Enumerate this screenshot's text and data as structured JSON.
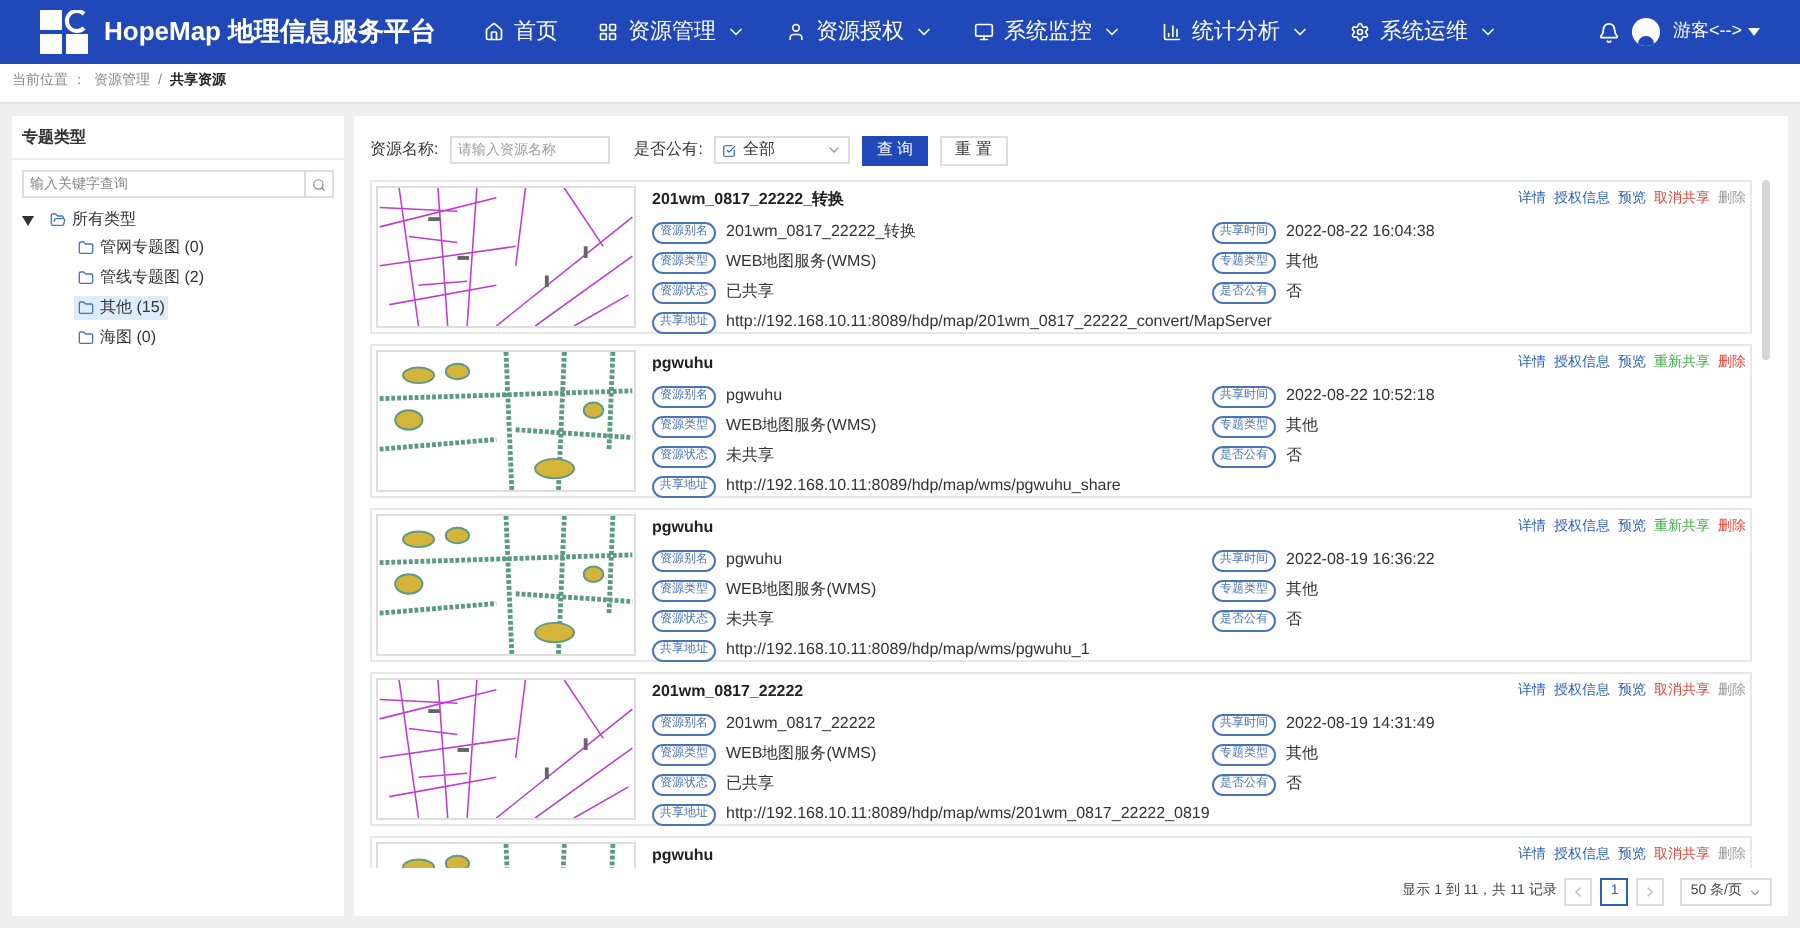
{
  "header": {
    "title": "HopeMap 地理信息服务平台",
    "nav": [
      {
        "label": "首页",
        "dropdown": false
      },
      {
        "label": "资源管理",
        "dropdown": true
      },
      {
        "label": "资源授权",
        "dropdown": true
      },
      {
        "label": "系统监控",
        "dropdown": true
      },
      {
        "label": "统计分析",
        "dropdown": true
      },
      {
        "label": "系统运维",
        "dropdown": true
      }
    ],
    "user": "游客<-->"
  },
  "breadcrumb": {
    "label": "当前位置 ：",
    "items": [
      {
        "label": "资源管理",
        "current": false
      },
      {
        "label": "共享资源",
        "current": true
      }
    ],
    "separator": "/"
  },
  "sidebar": {
    "title": "专题类型",
    "search_placeholder": "输入关键字查询",
    "tree": [
      {
        "label": "所有类型",
        "expanded": true,
        "selected": false,
        "children": [
          {
            "label": "管网专题图 (0)",
            "selected": false
          },
          {
            "label": "管线专题图 (2)",
            "selected": false
          },
          {
            "label": "其他 (15)",
            "selected": true
          },
          {
            "label": "海图 (0)",
            "selected": false
          }
        ]
      }
    ]
  },
  "filters": {
    "name_label": "资源名称:",
    "name_placeholder": "请输入资源名称",
    "public_label": "是否公有:",
    "public_value": "全部",
    "public_checked": true,
    "query_button": "查 询",
    "reset_button": "重 置"
  },
  "cards": [
    {
      "title": "201wm_0817_22222_转换",
      "kind": "lines",
      "actions": [
        {
          "label": "详情",
          "kind": "link"
        },
        {
          "label": "授权信息",
          "kind": "link"
        },
        {
          "label": "预览",
          "kind": "link"
        },
        {
          "label": "取消共享",
          "kind": "danger"
        },
        {
          "label": "删除",
          "kind": "muted"
        }
      ],
      "fields": [
        {
          "label": "资源别名",
          "value": "201wm_0817_22222_转换",
          "kind": "pair"
        },
        {
          "label": "共享时间",
          "value": "2022-08-22 16:04:38",
          "kind": "pair"
        },
        {
          "label": "资源类型",
          "value": "WEB地图服务(WMS)",
          "kind": "pair"
        },
        {
          "label": "专题类型",
          "value": "其他",
          "kind": "pair"
        },
        {
          "label": "资源状态",
          "value": "已共享",
          "kind": "pair"
        },
        {
          "label": "是否公有",
          "value": "否",
          "kind": "pair"
        },
        {
          "label": "共享地址",
          "value": "http://192.168.10.11:8089/hdp/map/201wm_0817_22222_convert/MapServer",
          "kind": "wide"
        }
      ]
    },
    {
      "title": "pgwuhu",
      "kind": "patches",
      "actions": [
        {
          "label": "详情",
          "kind": "link"
        },
        {
          "label": "授权信息",
          "kind": "link"
        },
        {
          "label": "预览",
          "kind": "link"
        },
        {
          "label": "重新共享",
          "kind": "success"
        },
        {
          "label": "删除",
          "kind": "danger"
        }
      ],
      "fields": [
        {
          "label": "资源别名",
          "value": "pgwuhu",
          "kind": "pair"
        },
        {
          "label": "共享时间",
          "value": "2022-08-22 10:52:18",
          "kind": "pair"
        },
        {
          "label": "资源类型",
          "value": "WEB地图服务(WMS)",
          "kind": "pair"
        },
        {
          "label": "专题类型",
          "value": "其他",
          "kind": "pair"
        },
        {
          "label": "资源状态",
          "value": "未共享",
          "kind": "pair"
        },
        {
          "label": "是否公有",
          "value": "否",
          "kind": "pair"
        },
        {
          "label": "共享地址",
          "value": "http://192.168.10.11:8089/hdp/map/wms/pgwuhu_share",
          "kind": "wide"
        }
      ]
    },
    {
      "title": "pgwuhu",
      "kind": "patches",
      "actions": [
        {
          "label": "详情",
          "kind": "link"
        },
        {
          "label": "授权信息",
          "kind": "link"
        },
        {
          "label": "预览",
          "kind": "link"
        },
        {
          "label": "重新共享",
          "kind": "success"
        },
        {
          "label": "删除",
          "kind": "danger"
        }
      ],
      "fields": [
        {
          "label": "资源别名",
          "value": "pgwuhu",
          "kind": "pair"
        },
        {
          "label": "共享时间",
          "value": "2022-08-19 16:36:22",
          "kind": "pair"
        },
        {
          "label": "资源类型",
          "value": "WEB地图服务(WMS)",
          "kind": "pair"
        },
        {
          "label": "专题类型",
          "value": "其他",
          "kind": "pair"
        },
        {
          "label": "资源状态",
          "value": "未共享",
          "kind": "pair"
        },
        {
          "label": "是否公有",
          "value": "否",
          "kind": "pair"
        },
        {
          "label": "共享地址",
          "value": "http://192.168.10.11:8089/hdp/map/wms/pgwuhu_1",
          "kind": "wide"
        }
      ]
    },
    {
      "title": "201wm_0817_22222",
      "kind": "lines",
      "actions": [
        {
          "label": "详情",
          "kind": "link"
        },
        {
          "label": "授权信息",
          "kind": "link"
        },
        {
          "label": "预览",
          "kind": "link"
        },
        {
          "label": "取消共享",
          "kind": "danger"
        },
        {
          "label": "删除",
          "kind": "muted"
        }
      ],
      "fields": [
        {
          "label": "资源别名",
          "value": "201wm_0817_22222",
          "kind": "pair"
        },
        {
          "label": "共享时间",
          "value": "2022-08-19 14:31:49",
          "kind": "pair"
        },
        {
          "label": "资源类型",
          "value": "WEB地图服务(WMS)",
          "kind": "pair"
        },
        {
          "label": "专题类型",
          "value": "其他",
          "kind": "pair"
        },
        {
          "label": "资源状态",
          "value": "已共享",
          "kind": "pair"
        },
        {
          "label": "是否公有",
          "value": "否",
          "kind": "pair"
        },
        {
          "label": "共享地址",
          "value": "http://192.168.10.11:8089/hdp/map/wms/201wm_0817_22222_0819",
          "kind": "wide"
        }
      ]
    },
    {
      "title": "pgwuhu",
      "kind": "patches",
      "actions": [
        {
          "label": "详情",
          "kind": "link"
        },
        {
          "label": "授权信息",
          "kind": "link"
        },
        {
          "label": "预览",
          "kind": "link"
        },
        {
          "label": "取消共享",
          "kind": "danger"
        },
        {
          "label": "删除",
          "kind": "muted"
        }
      ]
    }
  ],
  "pagination": {
    "summary": "显示 1 到 11，共 11 记录",
    "pages": [
      {
        "label": "1",
        "selected": true
      }
    ],
    "page_size": "50 条/页"
  }
}
